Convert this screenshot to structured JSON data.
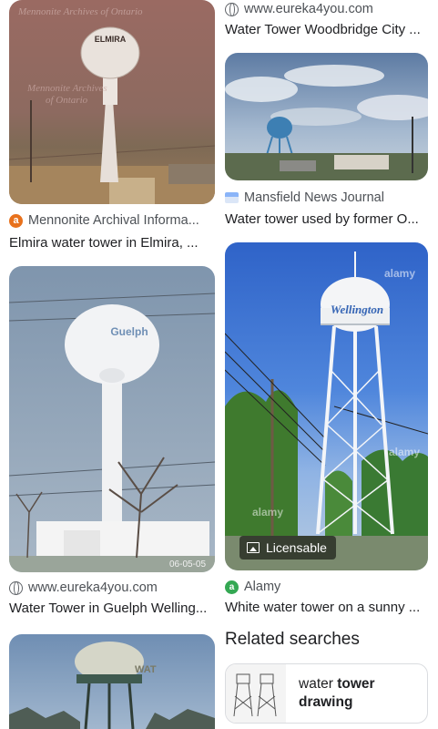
{
  "results": [
    {
      "source": "Mennonite Archival Informa...",
      "title": "Elmira water tower in Elmira, ...",
      "favicon": "letter-a-icon",
      "image_text": "ELMIRA",
      "watermark": "Mennonite Archives of Ontario"
    },
    {
      "source": "www.eureka4you.com",
      "title": "Water Tower Woodbridge City ...",
      "favicon": "globe-icon"
    },
    {
      "source": "Mansfield News Journal",
      "title": "Water tower used by former O...",
      "favicon": "news-icon"
    },
    {
      "source": "www.eureka4you.com",
      "title": "Water Tower in Guelph Welling...",
      "favicon": "globe-icon",
      "image_text": "Guelph",
      "date_stamp": "06-05-05"
    },
    {
      "source": "Alamy",
      "title": "White water tower on a sunny ...",
      "favicon": "alamy-icon",
      "badge": "Licensable",
      "image_text": "Wellington",
      "watermark": "alamy"
    },
    {
      "source": "",
      "title": "",
      "image_text": "WAT"
    }
  ],
  "related": {
    "heading": "Related searches",
    "items": [
      {
        "text_plain": "water ",
        "text_bold": "tower",
        "text_line2": "drawing"
      }
    ]
  },
  "colors": {
    "accent_orange": "#e8711c",
    "alamy_green": "#34a853"
  }
}
